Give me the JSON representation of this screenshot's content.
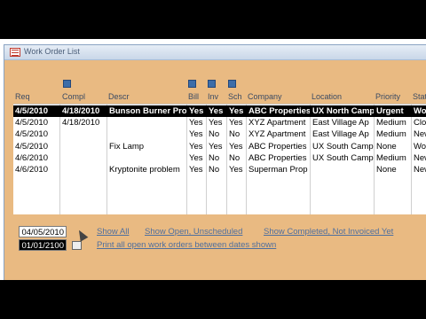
{
  "window": {
    "title": "Work Order List"
  },
  "columns": [
    {
      "key": "req",
      "label": "Req"
    },
    {
      "key": "compl",
      "label": "Compl"
    },
    {
      "key": "descr",
      "label": "Descr"
    },
    {
      "key": "bill",
      "label": "Bill"
    },
    {
      "key": "inv",
      "label": "Inv"
    },
    {
      "key": "sch",
      "label": "Sch"
    },
    {
      "key": "company",
      "label": "Company"
    },
    {
      "key": "location",
      "label": "Location"
    },
    {
      "key": "priority",
      "label": "Priority"
    },
    {
      "key": "status",
      "label": "Statu"
    }
  ],
  "rows": [
    {
      "req": "4/5/2010",
      "compl": "4/18/2010",
      "descr": "Bunson Burner Prob",
      "bill": "Yes",
      "inv": "Yes",
      "sch": "Yes",
      "company": "ABC Properties",
      "location": "UX North Camp",
      "priority": "Urgent",
      "status": "Work",
      "selected": true
    },
    {
      "req": "4/5/2010",
      "compl": "4/18/2010",
      "descr": "",
      "bill": "Yes",
      "inv": "Yes",
      "sch": "Yes",
      "company": "XYZ Apartment",
      "location": "East Village Ap",
      "priority": "Medium",
      "status": "Close",
      "selected": false
    },
    {
      "req": "4/5/2010",
      "compl": "",
      "descr": "",
      "bill": "Yes",
      "inv": "No",
      "sch": "No",
      "company": "XYZ Apartment",
      "location": "East Village Ap",
      "priority": "Medium",
      "status": "New",
      "selected": false
    },
    {
      "req": "4/5/2010",
      "compl": "",
      "descr": "Fix Lamp",
      "bill": "Yes",
      "inv": "Yes",
      "sch": "Yes",
      "company": "ABC Properties",
      "location": "UX South Camp",
      "priority": "None",
      "status": "Work",
      "selected": false
    },
    {
      "req": "4/6/2010",
      "compl": "",
      "descr": "",
      "bill": "Yes",
      "inv": "No",
      "sch": "No",
      "company": "ABC Properties",
      "location": "UX South Camp",
      "priority": "Medium",
      "status": "New",
      "selected": false
    },
    {
      "req": "4/6/2010",
      "compl": "",
      "descr": "Kryptonite problem",
      "bill": "Yes",
      "inv": "No",
      "sch": "Yes",
      "company": "Superman Prop",
      "location": "",
      "priority": "None",
      "status": "New",
      "selected": false
    }
  ],
  "filters": {
    "date_start": "04/05/2010",
    "date_end": "01/01/2100",
    "show_all": "Show All",
    "show_open": "Show Open, Unscheduled",
    "show_completed": "Show Completed, Not Invoiced Yet",
    "print_all": "Print all open work orders between dates shown"
  }
}
